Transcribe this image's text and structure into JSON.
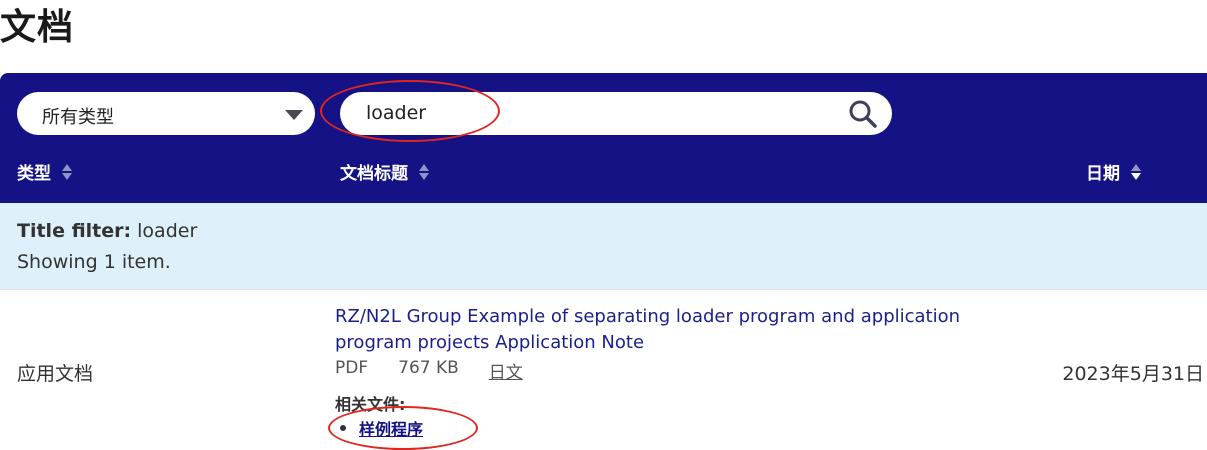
{
  "page": {
    "title": "文档"
  },
  "filters": {
    "type_select_value": "所有类型",
    "search_value": "loader"
  },
  "columns": {
    "type": "类型",
    "title": "文档标题",
    "date": "日期"
  },
  "filter_info": {
    "label": "Title filter:",
    "value": "loader",
    "count_text": "Showing 1 item."
  },
  "rows": [
    {
      "type": "应用文档",
      "title": "RZ/N2L Group Example of separating loader program and application program projects Application Note",
      "format": "PDF",
      "size": "767 KB",
      "language_link": "日文",
      "related_label": "相关文件:",
      "related_files": [
        "样例程序"
      ],
      "date": "2023年5月31日"
    }
  ],
  "colors": {
    "header_band": "#141285",
    "filter_band": "#def0fa",
    "link": "#1b1f8a",
    "annotation": "#e0261f"
  },
  "icons": {
    "search": "search-icon",
    "dropdown": "chevron-down-icon",
    "sort": "sort-icon"
  }
}
